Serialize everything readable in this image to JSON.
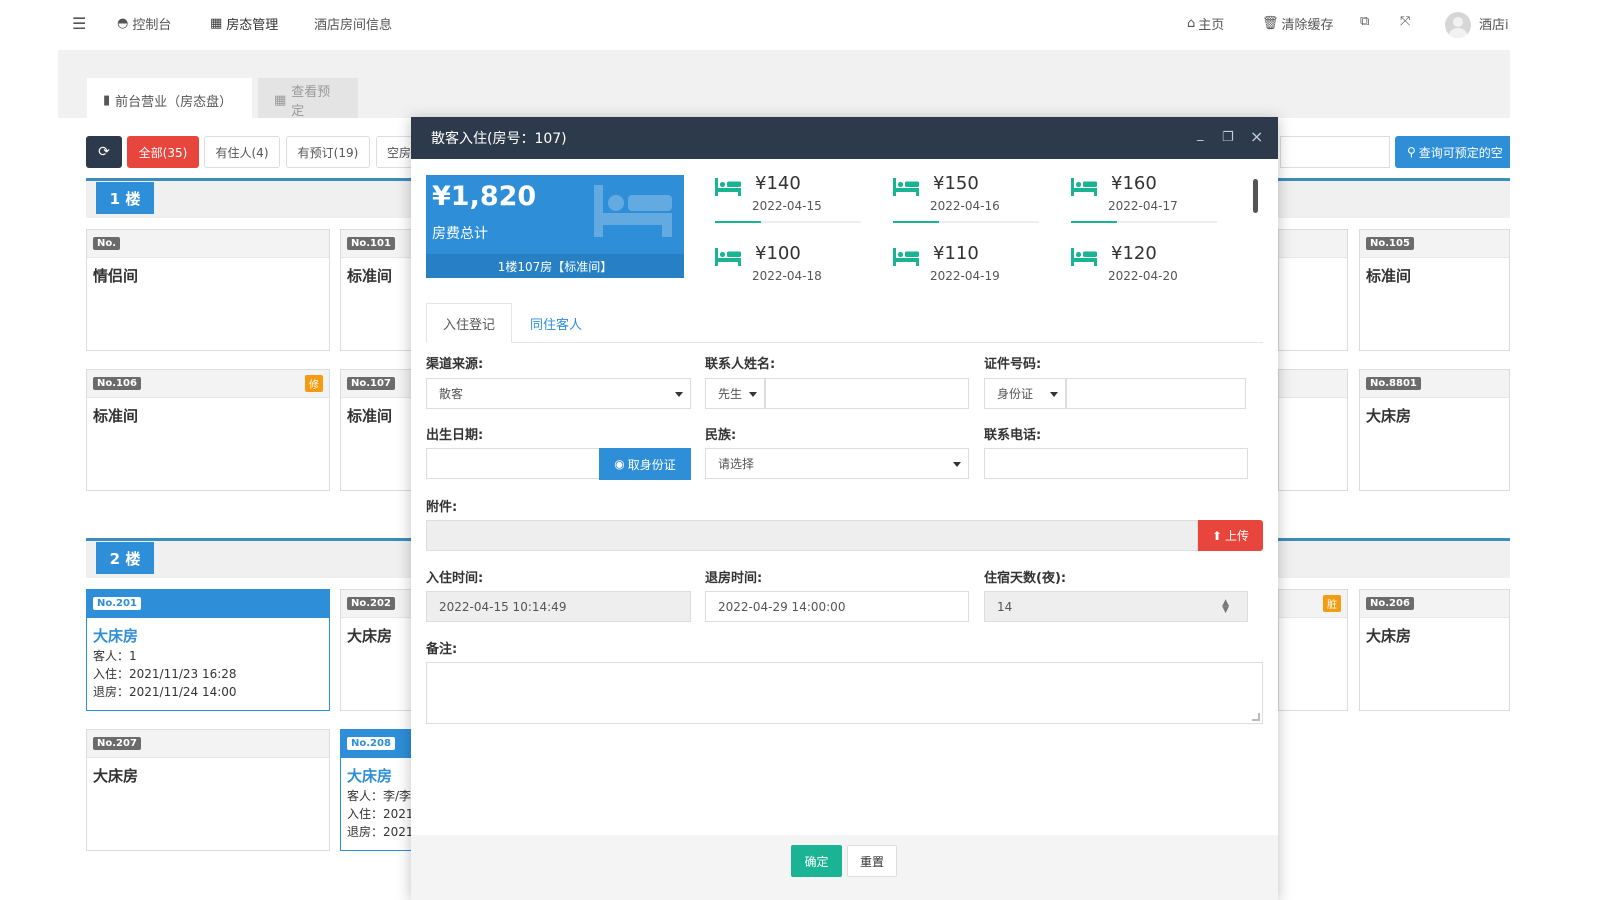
{
  "topbar": {
    "menu_icon": "hamburger-icon",
    "nav": [
      {
        "label": "控制台",
        "icon": "dashboard-icon"
      },
      {
        "label": "房态管理",
        "icon": "calendar-icon"
      },
      {
        "label": "酒店房间信息"
      }
    ],
    "home_label": "主页",
    "clear_cache_label": "清除缓存",
    "user_label": "酒店i"
  },
  "tabs": {
    "frontdesk_label": "前台营业（房态盘）",
    "reservation_label": "查看预定"
  },
  "filters": {
    "all": "全部(35)",
    "occupied": "有住人(4)",
    "reserved": "有预订(19)",
    "vacant": "空房",
    "search_button": "查询可预定的空"
  },
  "floors": [
    {
      "label": "1 楼"
    },
    {
      "label": "2 楼"
    }
  ],
  "rooms": {
    "r1": {
      "no": "No.",
      "type": "情侣间"
    },
    "r101": {
      "no": "No.101",
      "type": "标准间"
    },
    "r105": {
      "no": "No.105",
      "type": "标准间"
    },
    "r106": {
      "no": "No.106",
      "type": "标准间",
      "tag": "修"
    },
    "r107": {
      "no": "No.107",
      "type": "标准间"
    },
    "r8801": {
      "no": "No.8801",
      "type": "大床房"
    },
    "r201": {
      "no": "No.201",
      "type": "大床房",
      "guests": "客人：1",
      "checkin": "入住：2021/11/23 16:28",
      "checkout": "退房：2021/11/24 14:00"
    },
    "r202": {
      "no": "No.202",
      "type": "大床房"
    },
    "r205": {
      "tag": "脏"
    },
    "r206": {
      "no": "No.206",
      "type": "大床房"
    },
    "r207": {
      "no": "No.207",
      "type": "大床房"
    },
    "r208": {
      "no": "No.208",
      "type": "大床房",
      "guests": "客人：李/李",
      "checkin": "入住：2021",
      "checkout": "退房：2021"
    }
  },
  "modal": {
    "title": "散客入住(房号：107)",
    "minimize": "_",
    "close": "×",
    "total_price": "¥1,820",
    "total_label": "房费总计",
    "room_line": "1楼107房【标准间】",
    "daily": [
      {
        "price": "¥140",
        "date": "2022-04-15"
      },
      {
        "price": "¥150",
        "date": "2022-04-16"
      },
      {
        "price": "¥160",
        "date": "2022-04-17"
      },
      {
        "price": "¥100",
        "date": "2022-04-18"
      },
      {
        "price": "¥110",
        "date": "2022-04-19"
      },
      {
        "price": "¥120",
        "date": "2022-04-20"
      }
    ],
    "tabs": {
      "checkin": "入住登记",
      "coguests": "同住客人"
    },
    "labels": {
      "channel": "渠道来源:",
      "contact_name": "联系人姓名:",
      "id_no": "证件号码:",
      "birth": "出生日期:",
      "ethnicity": "民族:",
      "phone": "联系电话:",
      "attachment": "附件:",
      "checkin_time": "入住时间:",
      "checkout_time": "退房时间:",
      "nights": "住宿天数(夜):",
      "remark": "备注:"
    },
    "values": {
      "channel": "散客",
      "title": "先生",
      "id_type": "身份证",
      "ethnicity_placeholder": "请选择",
      "checkin_time": "2022-04-15 10:14:49",
      "checkout_time": "2022-04-29 14:00:00",
      "nights": "14"
    },
    "buttons": {
      "read_id": "取身份证",
      "upload": "上传",
      "confirm": "确定",
      "reset": "重置"
    }
  }
}
